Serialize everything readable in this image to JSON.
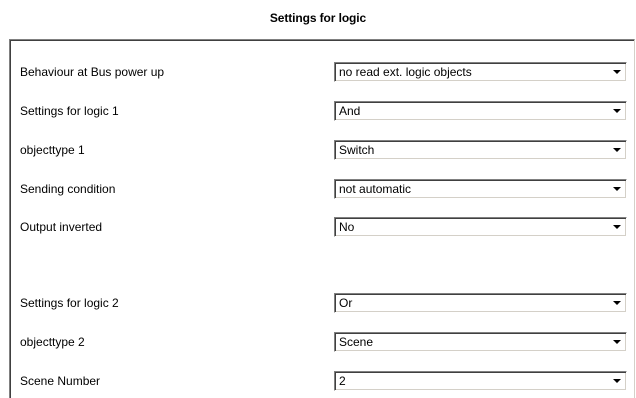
{
  "page": {
    "title": "Settings for logic"
  },
  "settings": [
    {
      "label": "Behaviour at Bus power up",
      "value": "no read ext. logic objects"
    },
    {
      "label": "Settings for logic 1",
      "value": "And"
    },
    {
      "label": "objecttype 1",
      "value": "Switch"
    },
    {
      "label": "Sending condition",
      "value": "not automatic"
    },
    {
      "label": "Output inverted",
      "value": "No"
    },
    {
      "label": "Settings for logic 2",
      "value": "Or"
    },
    {
      "label": "objecttype 2",
      "value": "Scene"
    },
    {
      "label": "Scene Number",
      "value": "2"
    }
  ],
  "icons": {
    "dropdown": "chevron-down-icon"
  }
}
